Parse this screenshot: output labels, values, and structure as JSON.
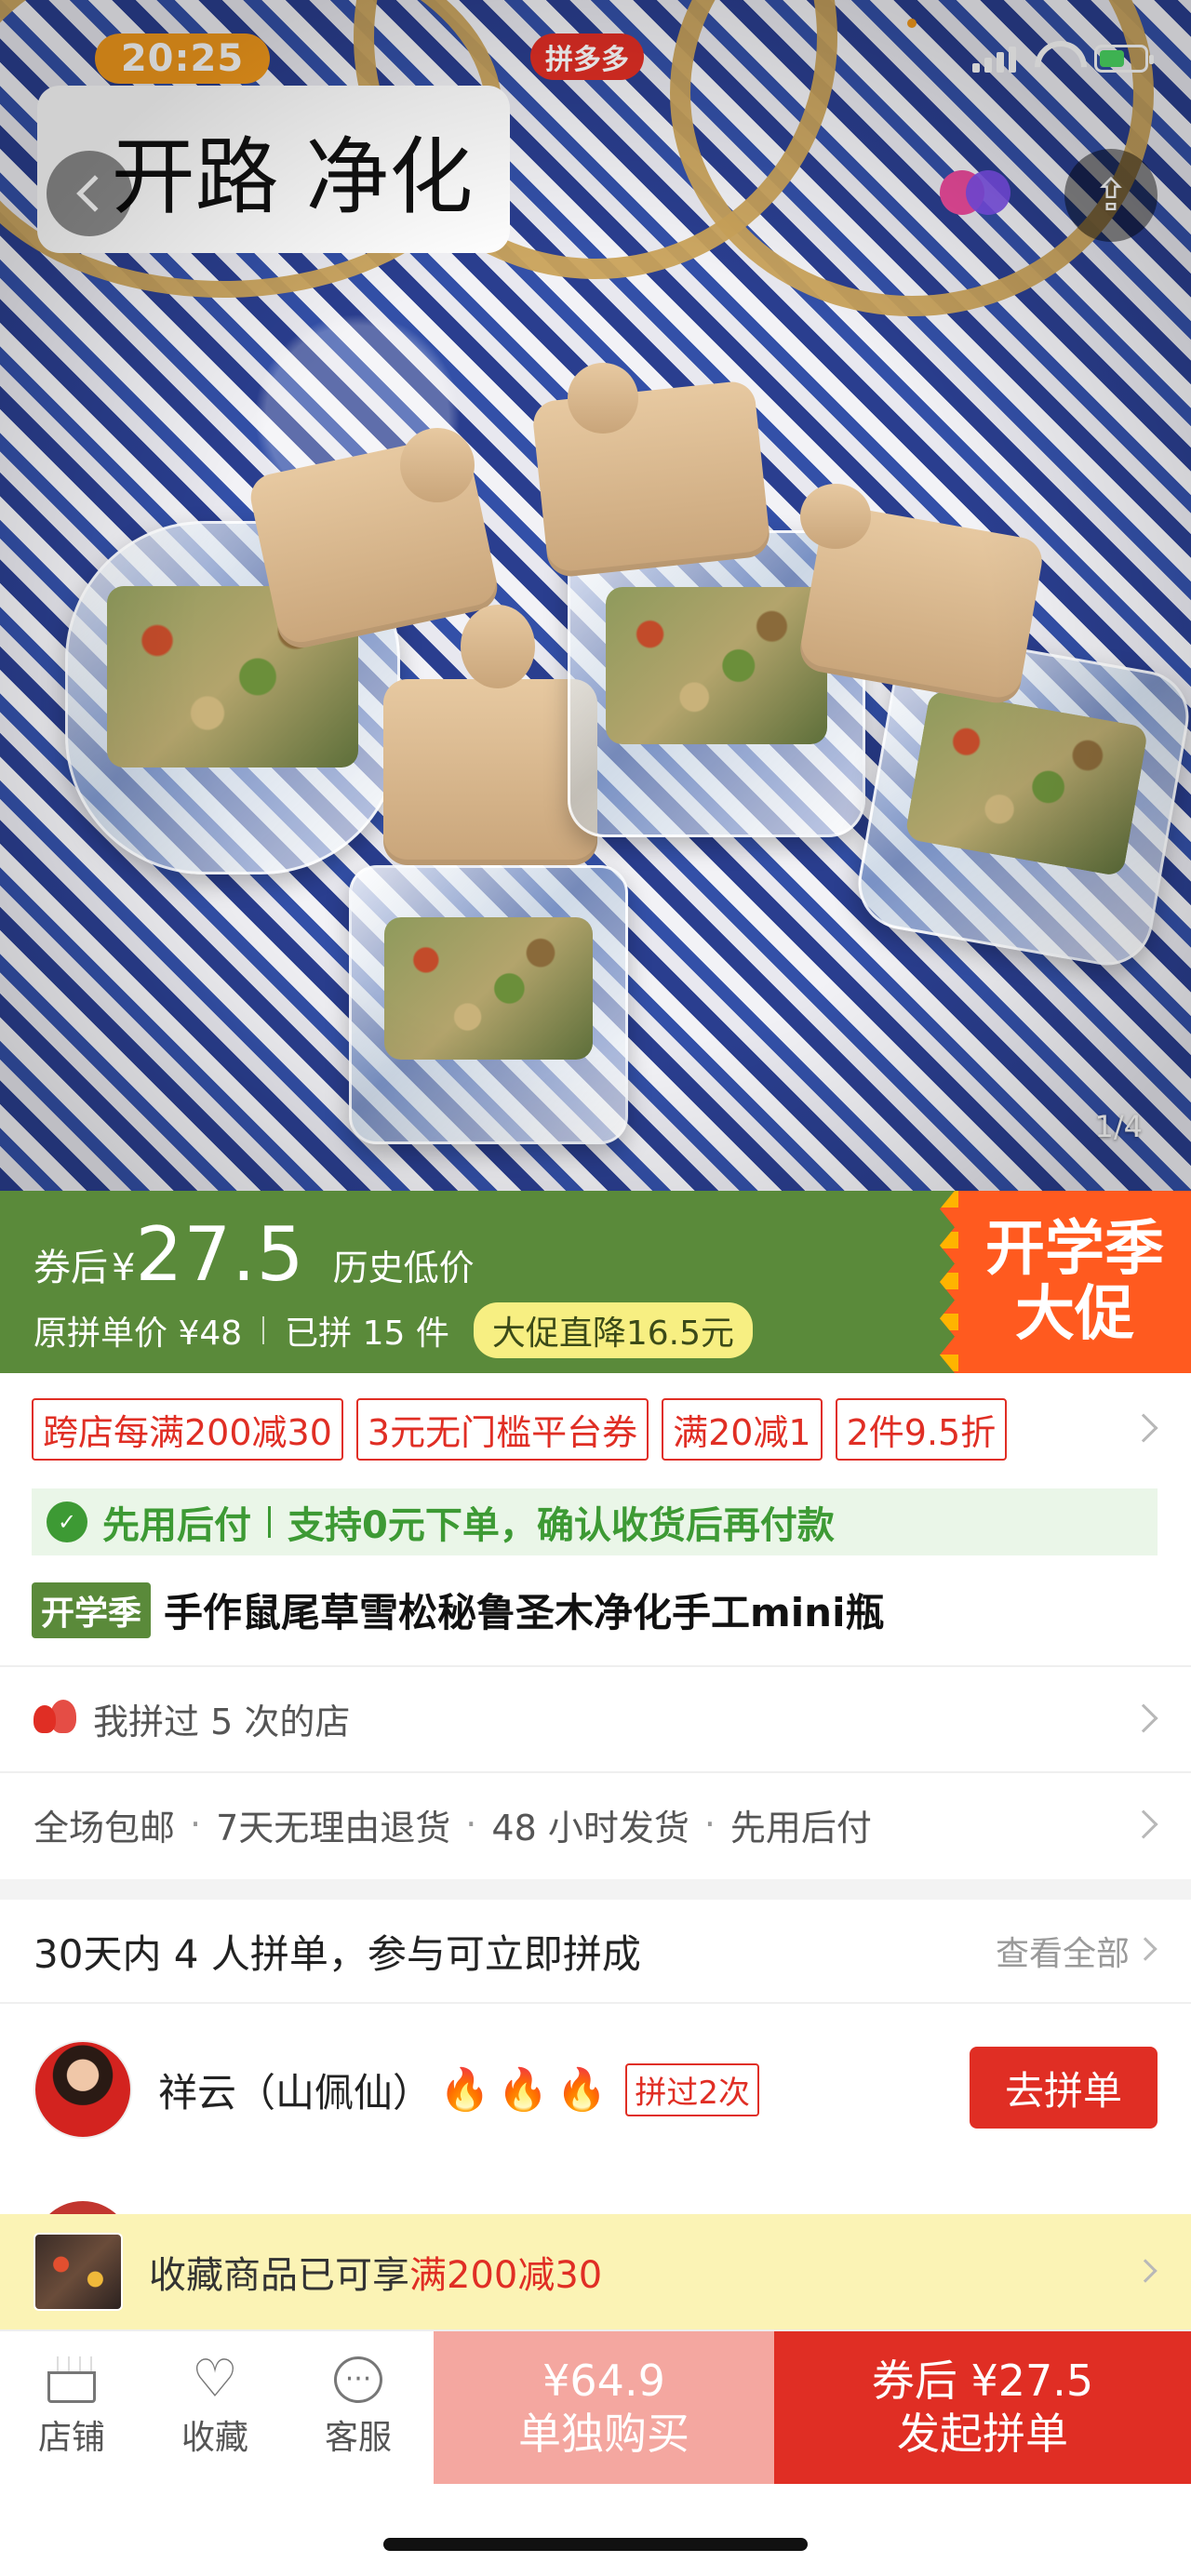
{
  "status": {
    "time": "20:25",
    "app_badge": "拼多多"
  },
  "hero": {
    "overlay_title": "开路 净化",
    "page_counter": "1/4"
  },
  "price": {
    "coupon_label": "券后",
    "currency": "¥",
    "after_coupon": "27.5",
    "history_low": "历史低价",
    "original_label": "原拼单价 ¥48",
    "sold": "已拼 15 件",
    "promo_pill": "大促直降16.5元",
    "promo_tag_line1": "开学季",
    "promo_tag_line2": "大促"
  },
  "coupons": [
    "跨店每满200减30",
    "3元无门槛平台券",
    "满20减1",
    "2件9.5折"
  ],
  "pay_first": {
    "title": "先用后付",
    "desc": "支持0元下单，确认收货后再付款"
  },
  "product": {
    "season_tag": "开学季",
    "title": "手作鼠尾草雪松秘鲁圣木净化手工mini瓶"
  },
  "shop_history": "我拼过 5 次的店",
  "services": [
    "全场包邮",
    "7天无理由退货",
    "48 小时发货",
    "先用后付"
  ],
  "group": {
    "header": "30天内 4 人拼单，参与可立即拼成",
    "see_all": "查看全部",
    "member_name": "祥云（山佩仙）",
    "member_badge": "拼过2次",
    "join_label": "去拼单"
  },
  "fav_banner": {
    "text": "收藏商品已可享",
    "highlight": "满200减30"
  },
  "bottom": {
    "tabs": [
      "店铺",
      "收藏",
      "客服"
    ],
    "solo_price": "¥64.9",
    "solo_label": "单独购买",
    "group_price": "券后 ¥27.5",
    "group_label": "发起拼单"
  },
  "colors": {
    "accent_red": "#e02e24",
    "promo_green": "#5a8a3a",
    "promo_orange": "#ff5a1f",
    "status_orange": "#f39a1c"
  }
}
